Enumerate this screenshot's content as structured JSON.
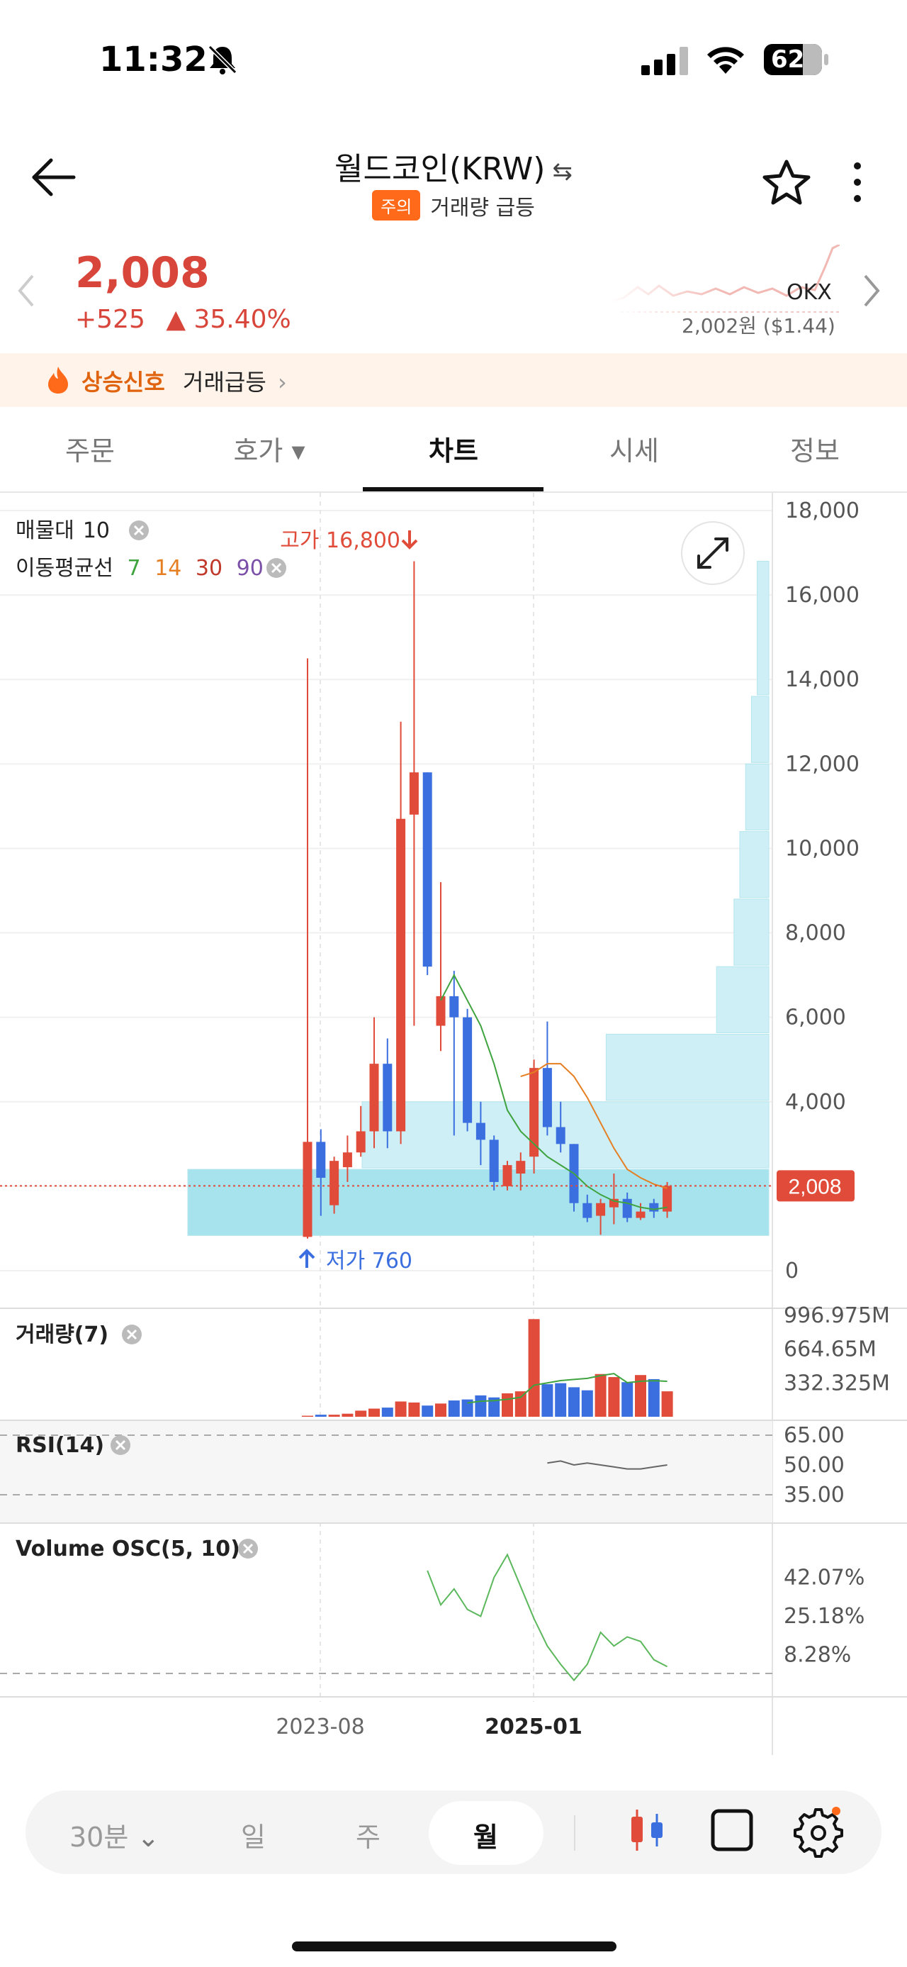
{
  "status_bar": {
    "time": "11:32",
    "battery": "62"
  },
  "header": {
    "title": "월드코인(KRW)",
    "warning_badge": "주의",
    "warning_text": "거래량 급등"
  },
  "price": {
    "current": "2,008",
    "change": "+525",
    "change_pct": "▲ 35.40%",
    "exchange": "OKX",
    "exchange_price": "2,002원 ($1.44)"
  },
  "signal": {
    "label": "상승신호",
    "value": "거래급등"
  },
  "tabs": [
    {
      "label": "주문"
    },
    {
      "label": "호가 ▾"
    },
    {
      "label": "차트"
    },
    {
      "label": "시세"
    },
    {
      "label": "정보"
    }
  ],
  "indicators": {
    "volume_profile": "매물대",
    "volume_profile_value": "10",
    "ma_label": "이동평균선",
    "ma_periods": [
      "7",
      "14",
      "30",
      "90"
    ],
    "ma_colors": [
      "#3fa33f",
      "#e67e22",
      "#c0392b",
      "#7b4fa8"
    ],
    "volume_panel": "거래량(7)",
    "rsi_panel": "RSI(14)",
    "osc_panel": "Volume OSC(5, 10)"
  },
  "annotations": {
    "high_label": "고가 16,800",
    "low_label": "저가 760",
    "current_tag": "2,008"
  },
  "price_axis": [
    "18,000",
    "16,000",
    "14,000",
    "12,000",
    "10,000",
    "8,000",
    "6,000",
    "4,000",
    "0"
  ],
  "volume_axis": [
    "996.975M",
    "664.65M",
    "332.325M"
  ],
  "rsi_axis": [
    "65.00",
    "50.00",
    "35.00"
  ],
  "osc_axis": [
    "42.07%",
    "25.18%",
    "8.28%"
  ],
  "x_axis": [
    "2023-08",
    "2025-01"
  ],
  "bottom_bar": {
    "interval": "30분",
    "day": "일",
    "week": "주",
    "month": "월"
  },
  "colors": {
    "up": "#e04b3a",
    "down": "#3b6fe0",
    "accent": "#ff6a1a"
  },
  "chart_data": {
    "type": "candlestick",
    "period": "monthly",
    "ylim": [
      0,
      18000
    ],
    "candles": [
      {
        "open": 800,
        "high": 14500,
        "low": 760,
        "close": 3050
      },
      {
        "open": 3050,
        "high": 3350,
        "low": 1300,
        "close": 2200
      },
      {
        "open": 1550,
        "high": 2700,
        "low": 1350,
        "close": 2600
      },
      {
        "open": 2450,
        "high": 3200,
        "low": 2100,
        "close": 2800
      },
      {
        "open": 2800,
        "high": 3900,
        "low": 2700,
        "close": 3300
      },
      {
        "open": 3300,
        "high": 6000,
        "low": 2900,
        "close": 4900
      },
      {
        "open": 4900,
        "high": 5500,
        "low": 2900,
        "close": 3300
      },
      {
        "open": 3300,
        "high": 13000,
        "low": 3000,
        "close": 10700
      },
      {
        "open": 10800,
        "high": 16800,
        "low": 5800,
        "close": 11800
      },
      {
        "open": 11800,
        "high": 11800,
        "low": 7000,
        "close": 7200
      },
      {
        "open": 5800,
        "high": 9200,
        "low": 5200,
        "close": 6500
      },
      {
        "open": 6500,
        "high": 7100,
        "low": 3200,
        "close": 6000
      },
      {
        "open": 6000,
        "high": 6200,
        "low": 3300,
        "close": 3500
      },
      {
        "open": 3500,
        "high": 4000,
        "low": 2500,
        "close": 3100
      },
      {
        "open": 3100,
        "high": 3200,
        "low": 1900,
        "close": 2100
      },
      {
        "open": 2000,
        "high": 2600,
        "low": 1900,
        "close": 2500
      },
      {
        "open": 2300,
        "high": 2800,
        "low": 1900,
        "close": 2600
      },
      {
        "open": 2700,
        "high": 5000,
        "low": 2300,
        "close": 4800
      },
      {
        "open": 4800,
        "high": 5900,
        "low": 3200,
        "close": 3400
      },
      {
        "open": 3400,
        "high": 4000,
        "low": 2800,
        "close": 3000
      },
      {
        "open": 3000,
        "high": 3000,
        "low": 1400,
        "close": 1600
      },
      {
        "open": 1600,
        "high": 1800,
        "low": 1150,
        "close": 1250
      },
      {
        "open": 1300,
        "high": 1700,
        "low": 850,
        "close": 1600
      },
      {
        "open": 1500,
        "high": 2300,
        "low": 1100,
        "close": 1700
      },
      {
        "open": 1700,
        "high": 1850,
        "low": 1150,
        "close": 1250
      },
      {
        "open": 1250,
        "high": 1600,
        "low": 1200,
        "close": 1400
      },
      {
        "open": 1600,
        "high": 1700,
        "low": 1250,
        "close": 1400
      },
      {
        "open": 1400,
        "high": 2100,
        "low": 1250,
        "close": 2008
      }
    ],
    "ma7": [
      null,
      null,
      null,
      null,
      null,
      null,
      null,
      null,
      null,
      null,
      6400,
      7000,
      6400,
      5800,
      4900,
      3800,
      3300,
      3000,
      2700,
      2500,
      2300,
      2000,
      1800,
      1650,
      1600,
      1500,
      1450,
      1500
    ],
    "ma14": [
      null,
      null,
      null,
      null,
      null,
      null,
      null,
      null,
      null,
      null,
      null,
      null,
      null,
      null,
      null,
      null,
      4600,
      4700,
      4900,
      4900,
      4600,
      4100,
      3500,
      2900,
      2400,
      2200,
      2050,
      1950
    ],
    "volume_million": [
      10,
      20,
      20,
      30,
      60,
      80,
      90,
      150,
      140,
      110,
      130,
      160,
      170,
      210,
      190,
      230,
      250,
      960,
      320,
      330,
      290,
      260,
      420,
      390,
      340,
      410,
      370,
      250
    ],
    "rsi_segment": [
      51,
      52,
      50,
      51,
      50,
      49,
      48,
      48,
      49,
      50
    ],
    "volume_osc_pct": [
      45,
      30,
      37,
      28,
      25,
      42,
      52,
      38,
      24,
      12,
      4,
      -3,
      4,
      18,
      12,
      16,
      14,
      6,
      3
    ],
    "volume_profile_price_bands": [
      {
        "low": 800,
        "high": 2400
      },
      {
        "low": 2400,
        "high": 4000
      },
      {
        "low": 4000,
        "high": 5600
      },
      {
        "low": 5600,
        "high": 7200
      },
      {
        "low": 7200,
        "high": 8800
      },
      {
        "low": 8800,
        "high": 10400
      },
      {
        "low": 10400,
        "high": 12000
      },
      {
        "low": 12000,
        "high": 13600
      },
      {
        "low": 13600,
        "high": 16800
      }
    ],
    "volume_profile_relative": [
      1.0,
      0.7,
      0.28,
      0.09,
      0.06,
      0.05,
      0.04,
      0.03,
      0.02
    ]
  }
}
